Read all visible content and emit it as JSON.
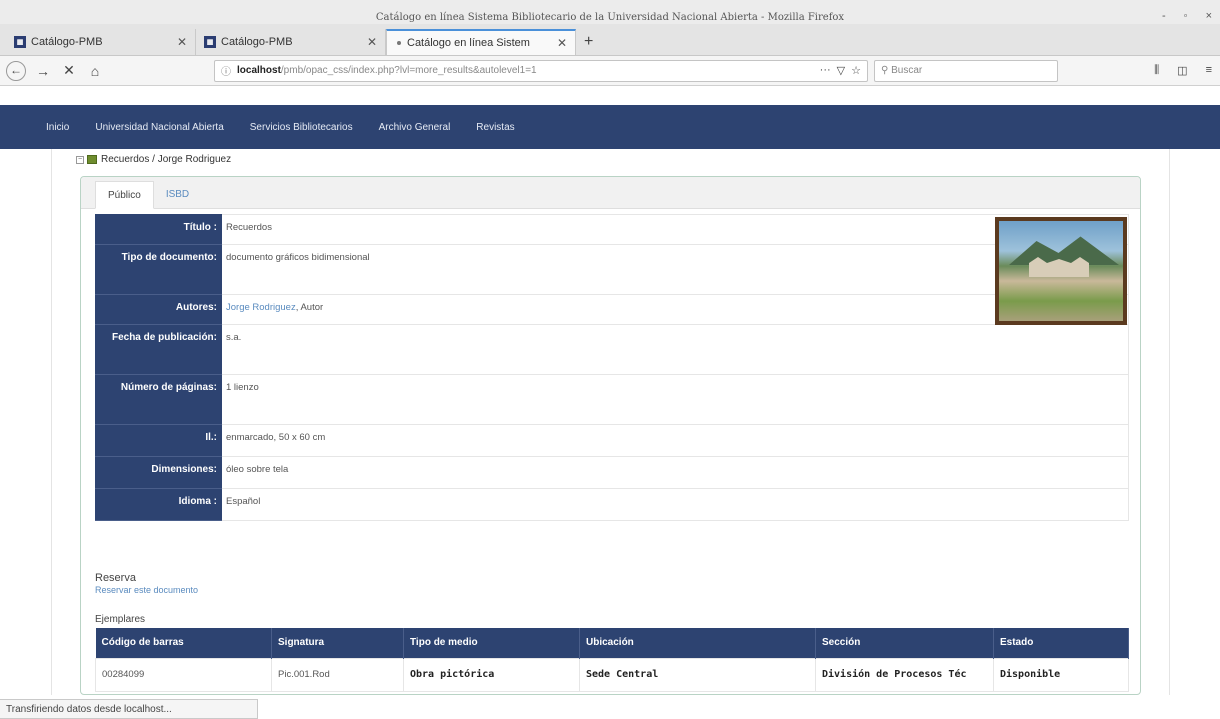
{
  "window": {
    "title": "Catálogo en línea Sistema Bibliotecario de la Universidad Nacional Abierta - Mozilla Firefox",
    "controls": [
      "-",
      "◦",
      "×"
    ]
  },
  "tabs": [
    {
      "label": "Catálogo-PMB",
      "active": false
    },
    {
      "label": "Catálogo-PMB",
      "active": false
    },
    {
      "label": "Catálogo en línea Sistem",
      "active": true
    }
  ],
  "toolbar": {
    "url_host": "localhost",
    "url_path": "/pmb/opac_css/index.php?lvl=more_results&autolevel1=1",
    "search_placeholder": "Buscar",
    "more": "···"
  },
  "site_nav": [
    "Inicio",
    "Universidad Nacional Abierta",
    "Servicios Bibliotecarios",
    "Archivo General",
    "Revistas"
  ],
  "breadcrumb": "Recuerdos / Jorge Rodriguez",
  "record_tabs": [
    "Público",
    "ISBD"
  ],
  "fields": [
    {
      "label": "Título :",
      "value": "Recuerdos"
    },
    {
      "label": "Tipo de documento:",
      "value": "documento gráficos bidimensional"
    },
    {
      "label": "Autores:",
      "value": "Jorge Rodriguez",
      "suffix": ", Autor"
    },
    {
      "label": "Fecha de publicación:",
      "value": "s.a."
    },
    {
      "label": "Número de páginas:",
      "value": "1 lienzo"
    },
    {
      "label": "Il.:",
      "value": "enmarcado, 50 x 60 cm"
    },
    {
      "label": "Dimensiones:",
      "value": "óleo sobre tela"
    },
    {
      "label": "Idioma :",
      "value": "Español"
    }
  ],
  "reserva": {
    "heading": "Reserva",
    "link": "Reservar este documento"
  },
  "ejemplares": {
    "title": "Ejemplares",
    "headers": [
      "Código de barras",
      "Signatura",
      "Tipo de medio",
      "Ubicación",
      "Sección",
      "Estado"
    ],
    "row": [
      "00284099",
      "Pic.001.Rod",
      "Obra pictórica",
      "Sede Central",
      "División de Procesos Téc",
      "Disponible"
    ]
  },
  "status": "Transfiriendo datos desde localhost..."
}
